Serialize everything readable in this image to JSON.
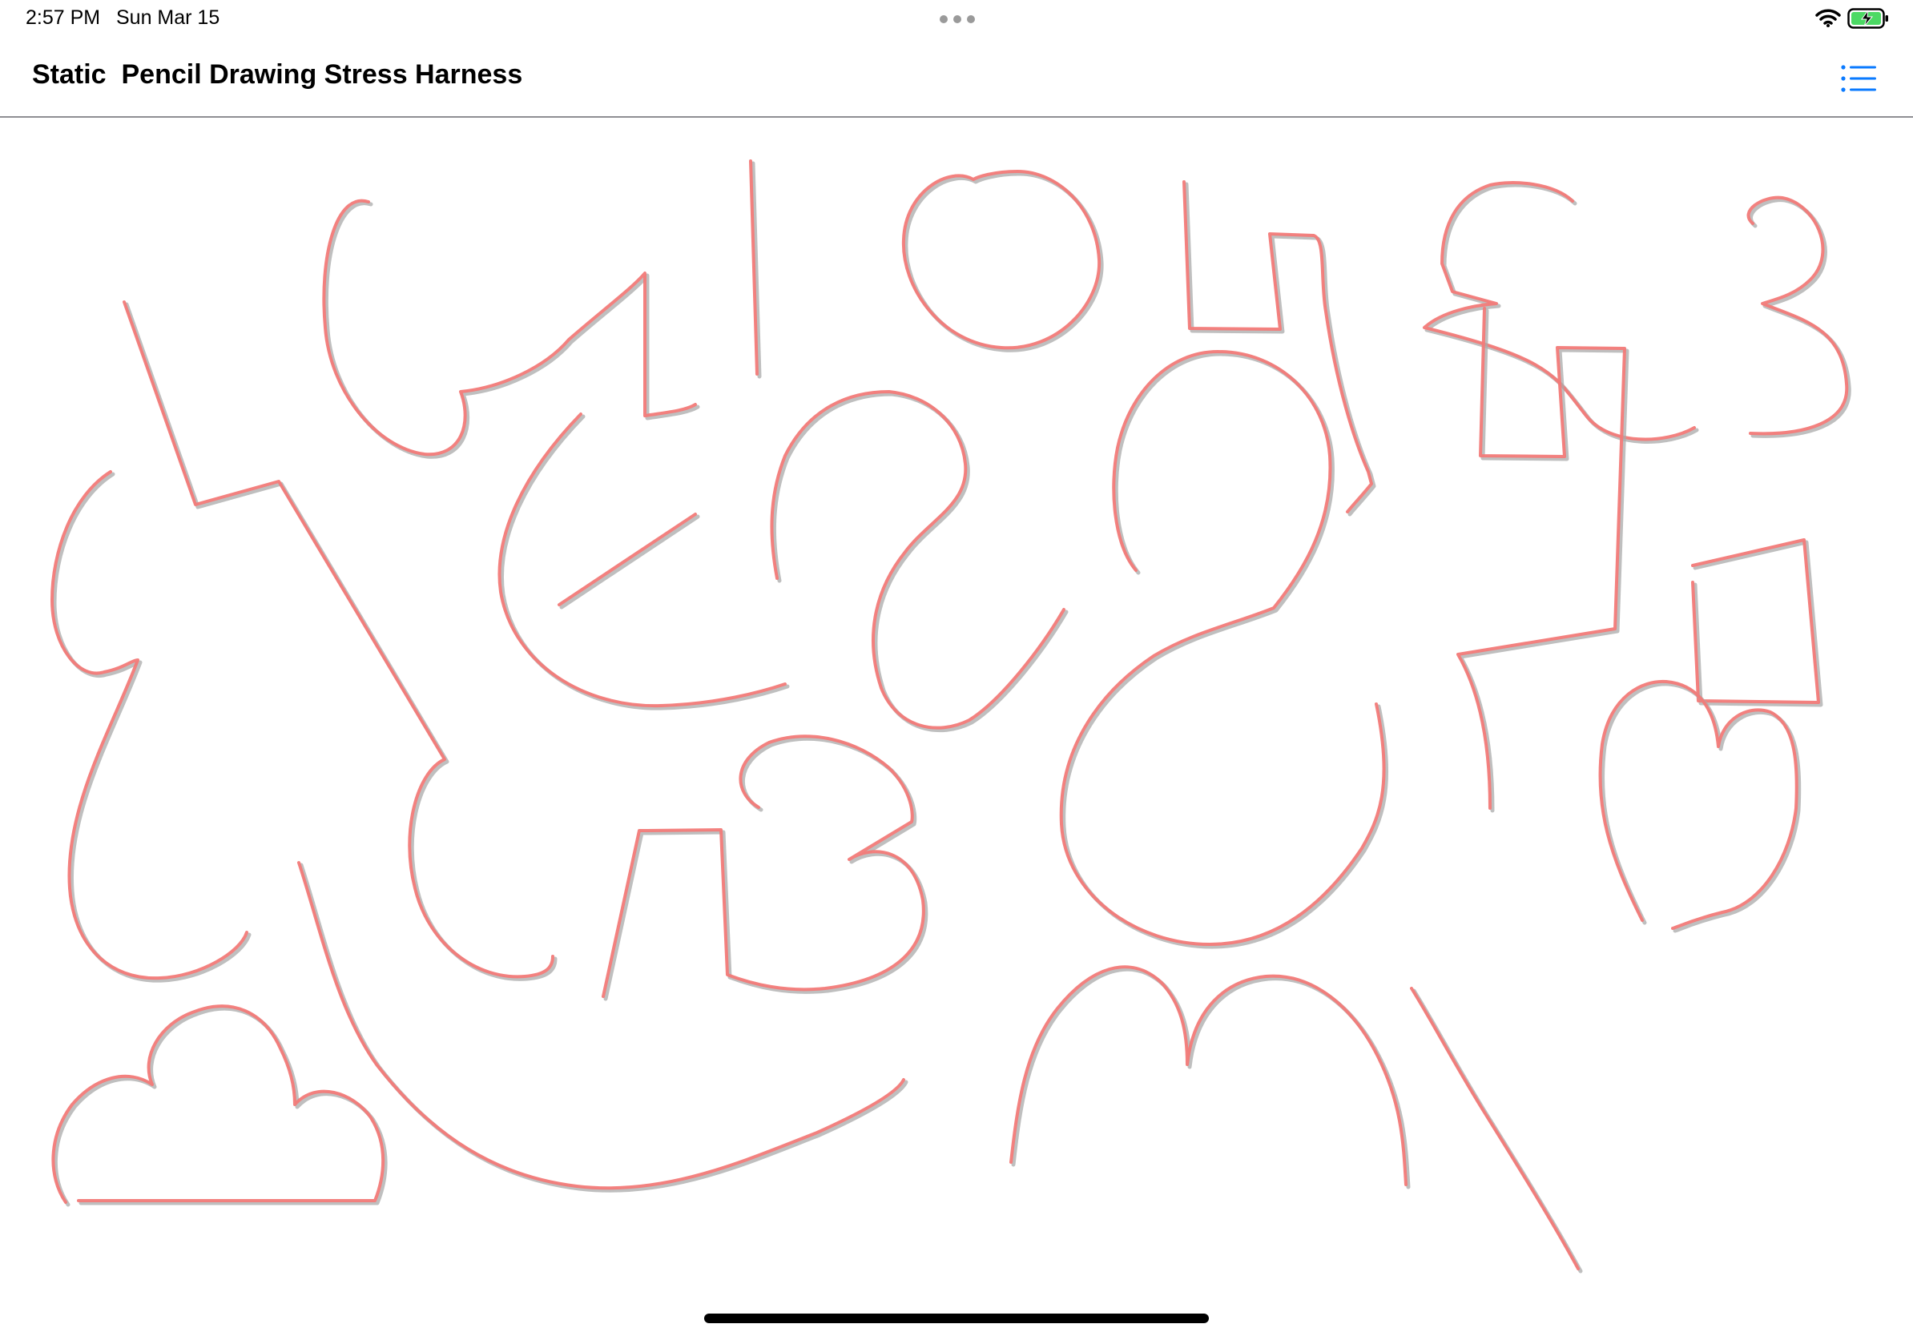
{
  "status_bar": {
    "time": "2:57 PM",
    "date": "Sun Mar 15",
    "icons": [
      "multitask-dots-icon",
      "wifi-icon",
      "battery-charging-icon"
    ],
    "battery_color": "#4cd964"
  },
  "nav": {
    "title": "Static  Pencil Drawing Stress Harness",
    "right_button_icon": "list-icon",
    "accent_color": "#0a7aff"
  },
  "canvas": {
    "stroke_colors": {
      "source": "#a9a9a9",
      "rendered": "#f27a78"
    }
  }
}
